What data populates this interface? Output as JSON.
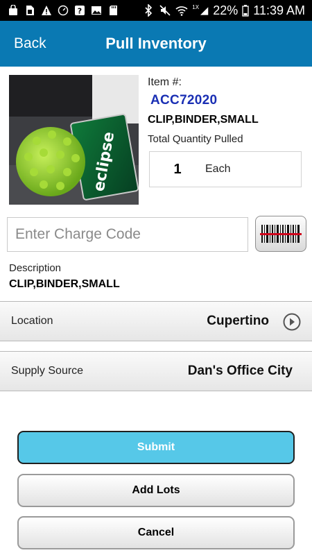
{
  "status_bar": {
    "left_icons": [
      "bag-icon",
      "sim-icon",
      "warning-icon",
      "speed-icon",
      "help-icon",
      "image-icon",
      "sd-card-icon"
    ],
    "right_icons": [
      "bluetooth-icon",
      "mute-icon",
      "wifi-icon",
      "signal-icon"
    ],
    "network_type": "1X",
    "battery": "22%",
    "time": "11:39 AM"
  },
  "header": {
    "back_label": "Back",
    "title": "Pull Inventory"
  },
  "item": {
    "number_label": "Item #:",
    "number": "ACC72020",
    "name": "CLIP,BINDER,SMALL",
    "total_label": "Total Quantity Pulled",
    "quantity": "1",
    "unit": "Each",
    "photo_text": "eclipse"
  },
  "charge_code": {
    "placeholder": "Enter Charge Code",
    "value": ""
  },
  "description": {
    "label": "Description",
    "value": "CLIP,BINDER,SMALL"
  },
  "location": {
    "label": "Location",
    "value": "Cupertino"
  },
  "supply_source": {
    "label": "Supply Source",
    "value": "Dan's Office City"
  },
  "buttons": {
    "submit": "Submit",
    "add_lots": "Add Lots",
    "cancel": "Cancel"
  },
  "colors": {
    "app_bar": "#0a79b3",
    "item_number": "#1a2fb4",
    "submit_bg": "#56c8e8",
    "scanner_line": "#d0021b"
  }
}
